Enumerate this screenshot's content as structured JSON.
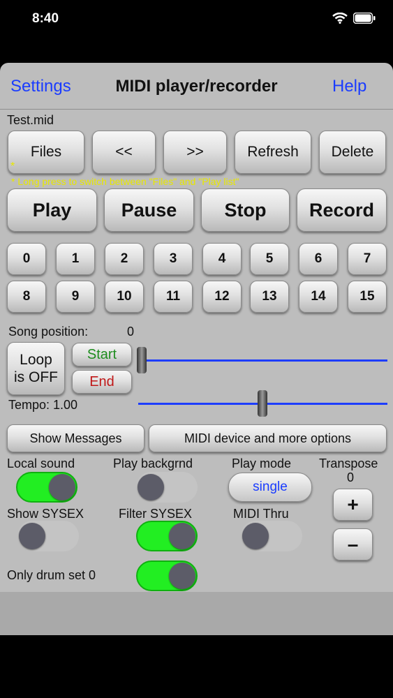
{
  "status": {
    "time": "8:40"
  },
  "nav": {
    "left": "Settings",
    "title": "MIDI player/recorder",
    "right": "Help"
  },
  "file_name": "Test.mid",
  "file_buttons": [
    "Files",
    "<<",
    ">>",
    "Refresh",
    "Delete"
  ],
  "star": "*",
  "hint": "* Long press to switch between \"Files\" and \"Play list\"",
  "transport": [
    "Play",
    "Pause",
    "Stop",
    "Record"
  ],
  "channels": [
    "0",
    "1",
    "2",
    "3",
    "4",
    "5",
    "6",
    "7",
    "8",
    "9",
    "10",
    "11",
    "12",
    "13",
    "14",
    "15"
  ],
  "song_position": {
    "label": "Song position:",
    "value": "0",
    "progress": 0
  },
  "loop": {
    "line1": "Loop",
    "line2": "is OFF"
  },
  "start_label": "Start",
  "end_label": "End",
  "tempo": {
    "label": "Tempo: 1.00",
    "position": 0.5
  },
  "show_messages": "Show Messages",
  "midi_device": "MIDI device and more options",
  "toggles": {
    "local_sound": {
      "label": "Local sound",
      "on": true
    },
    "play_background": {
      "label": "Play backgrnd",
      "on": false
    },
    "show_sysex": {
      "label": "Show SYSEX",
      "on": false
    },
    "filter_sysex": {
      "label": "Filter SYSEX",
      "on": true
    },
    "midi_thru": {
      "label": "MIDI Thru",
      "on": false
    },
    "only_drum_set": {
      "label": "Only drum set 0",
      "on": true
    }
  },
  "play_mode": {
    "label": "Play mode",
    "value": "single"
  },
  "transpose": {
    "label": "Transpose",
    "value": "0",
    "plus": "+",
    "minus": "–"
  },
  "colors": {
    "accent": "#1a3cff",
    "toggle_on": "#22ee22",
    "start": "#1e8c1e",
    "end": "#c01818",
    "hint": "#e8e800"
  }
}
